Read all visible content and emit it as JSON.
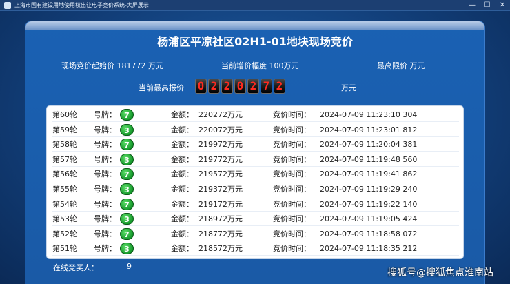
{
  "window": {
    "title": "上海市国有建设用地使用权出让电子竞价系统-大屏展示",
    "minimize": "—",
    "maximize": "☐",
    "close": "✕"
  },
  "auction": {
    "headline": "杨浦区平凉社区02H1-01地块现场竞价",
    "start_price_label": "现场竞价起始价 181772 万元",
    "increment_label": "当前增价幅度 100万元",
    "max_limit_label": "最高限价 万元",
    "current_highest_label": "当前最高报价",
    "current_highest_digits": [
      "0",
      "2",
      "2",
      "0",
      "2",
      "7",
      "2"
    ],
    "current_highest_unit": "万元"
  },
  "bids": [
    {
      "round": "第60轮",
      "plate_label": "号牌：",
      "plate": "7",
      "amount_label": "金额：",
      "amount": "220272万元",
      "time_label": "竞价时间：",
      "time": "2024-07-09 11:23:10 304"
    },
    {
      "round": "第59轮",
      "plate_label": "号牌：",
      "plate": "3",
      "amount_label": "金额：",
      "amount": "220072万元",
      "time_label": "竞价时间：",
      "time": "2024-07-09 11:23:01 812"
    },
    {
      "round": "第58轮",
      "plate_label": "号牌：",
      "plate": "7",
      "amount_label": "金额：",
      "amount": "219972万元",
      "time_label": "竞价时间：",
      "time": "2024-07-09 11:20:04 381"
    },
    {
      "round": "第57轮",
      "plate_label": "号牌：",
      "plate": "3",
      "amount_label": "金额：",
      "amount": "219772万元",
      "time_label": "竞价时间：",
      "time": "2024-07-09 11:19:48 560"
    },
    {
      "round": "第56轮",
      "plate_label": "号牌：",
      "plate": "7",
      "amount_label": "金额：",
      "amount": "219572万元",
      "time_label": "竞价时间：",
      "time": "2024-07-09 11:19:41 862"
    },
    {
      "round": "第55轮",
      "plate_label": "号牌：",
      "plate": "3",
      "amount_label": "金额：",
      "amount": "219372万元",
      "time_label": "竞价时间：",
      "time": "2024-07-09 11:19:29 240"
    },
    {
      "round": "第54轮",
      "plate_label": "号牌：",
      "plate": "7",
      "amount_label": "金额：",
      "amount": "219172万元",
      "time_label": "竞价时间：",
      "time": "2024-07-09 11:19:22 140"
    },
    {
      "round": "第53轮",
      "plate_label": "号牌：",
      "plate": "3",
      "amount_label": "金额：",
      "amount": "218972万元",
      "time_label": "竞价时间：",
      "time": "2024-07-09 11:19:05 424"
    },
    {
      "round": "第52轮",
      "plate_label": "号牌：",
      "plate": "7",
      "amount_label": "金额：",
      "amount": "218772万元",
      "time_label": "竞价时间：",
      "time": "2024-07-09 11:18:58 072"
    },
    {
      "round": "第51轮",
      "plate_label": "号牌：",
      "plate": "3",
      "amount_label": "金额：",
      "amount": "218572万元",
      "time_label": "竞价时间：",
      "time": "2024-07-09 11:18:35 212"
    }
  ],
  "footer": {
    "online_label": "在线竞买人：",
    "online_count": "9",
    "watermark": "搜狐号@搜狐焦点淮南站"
  }
}
